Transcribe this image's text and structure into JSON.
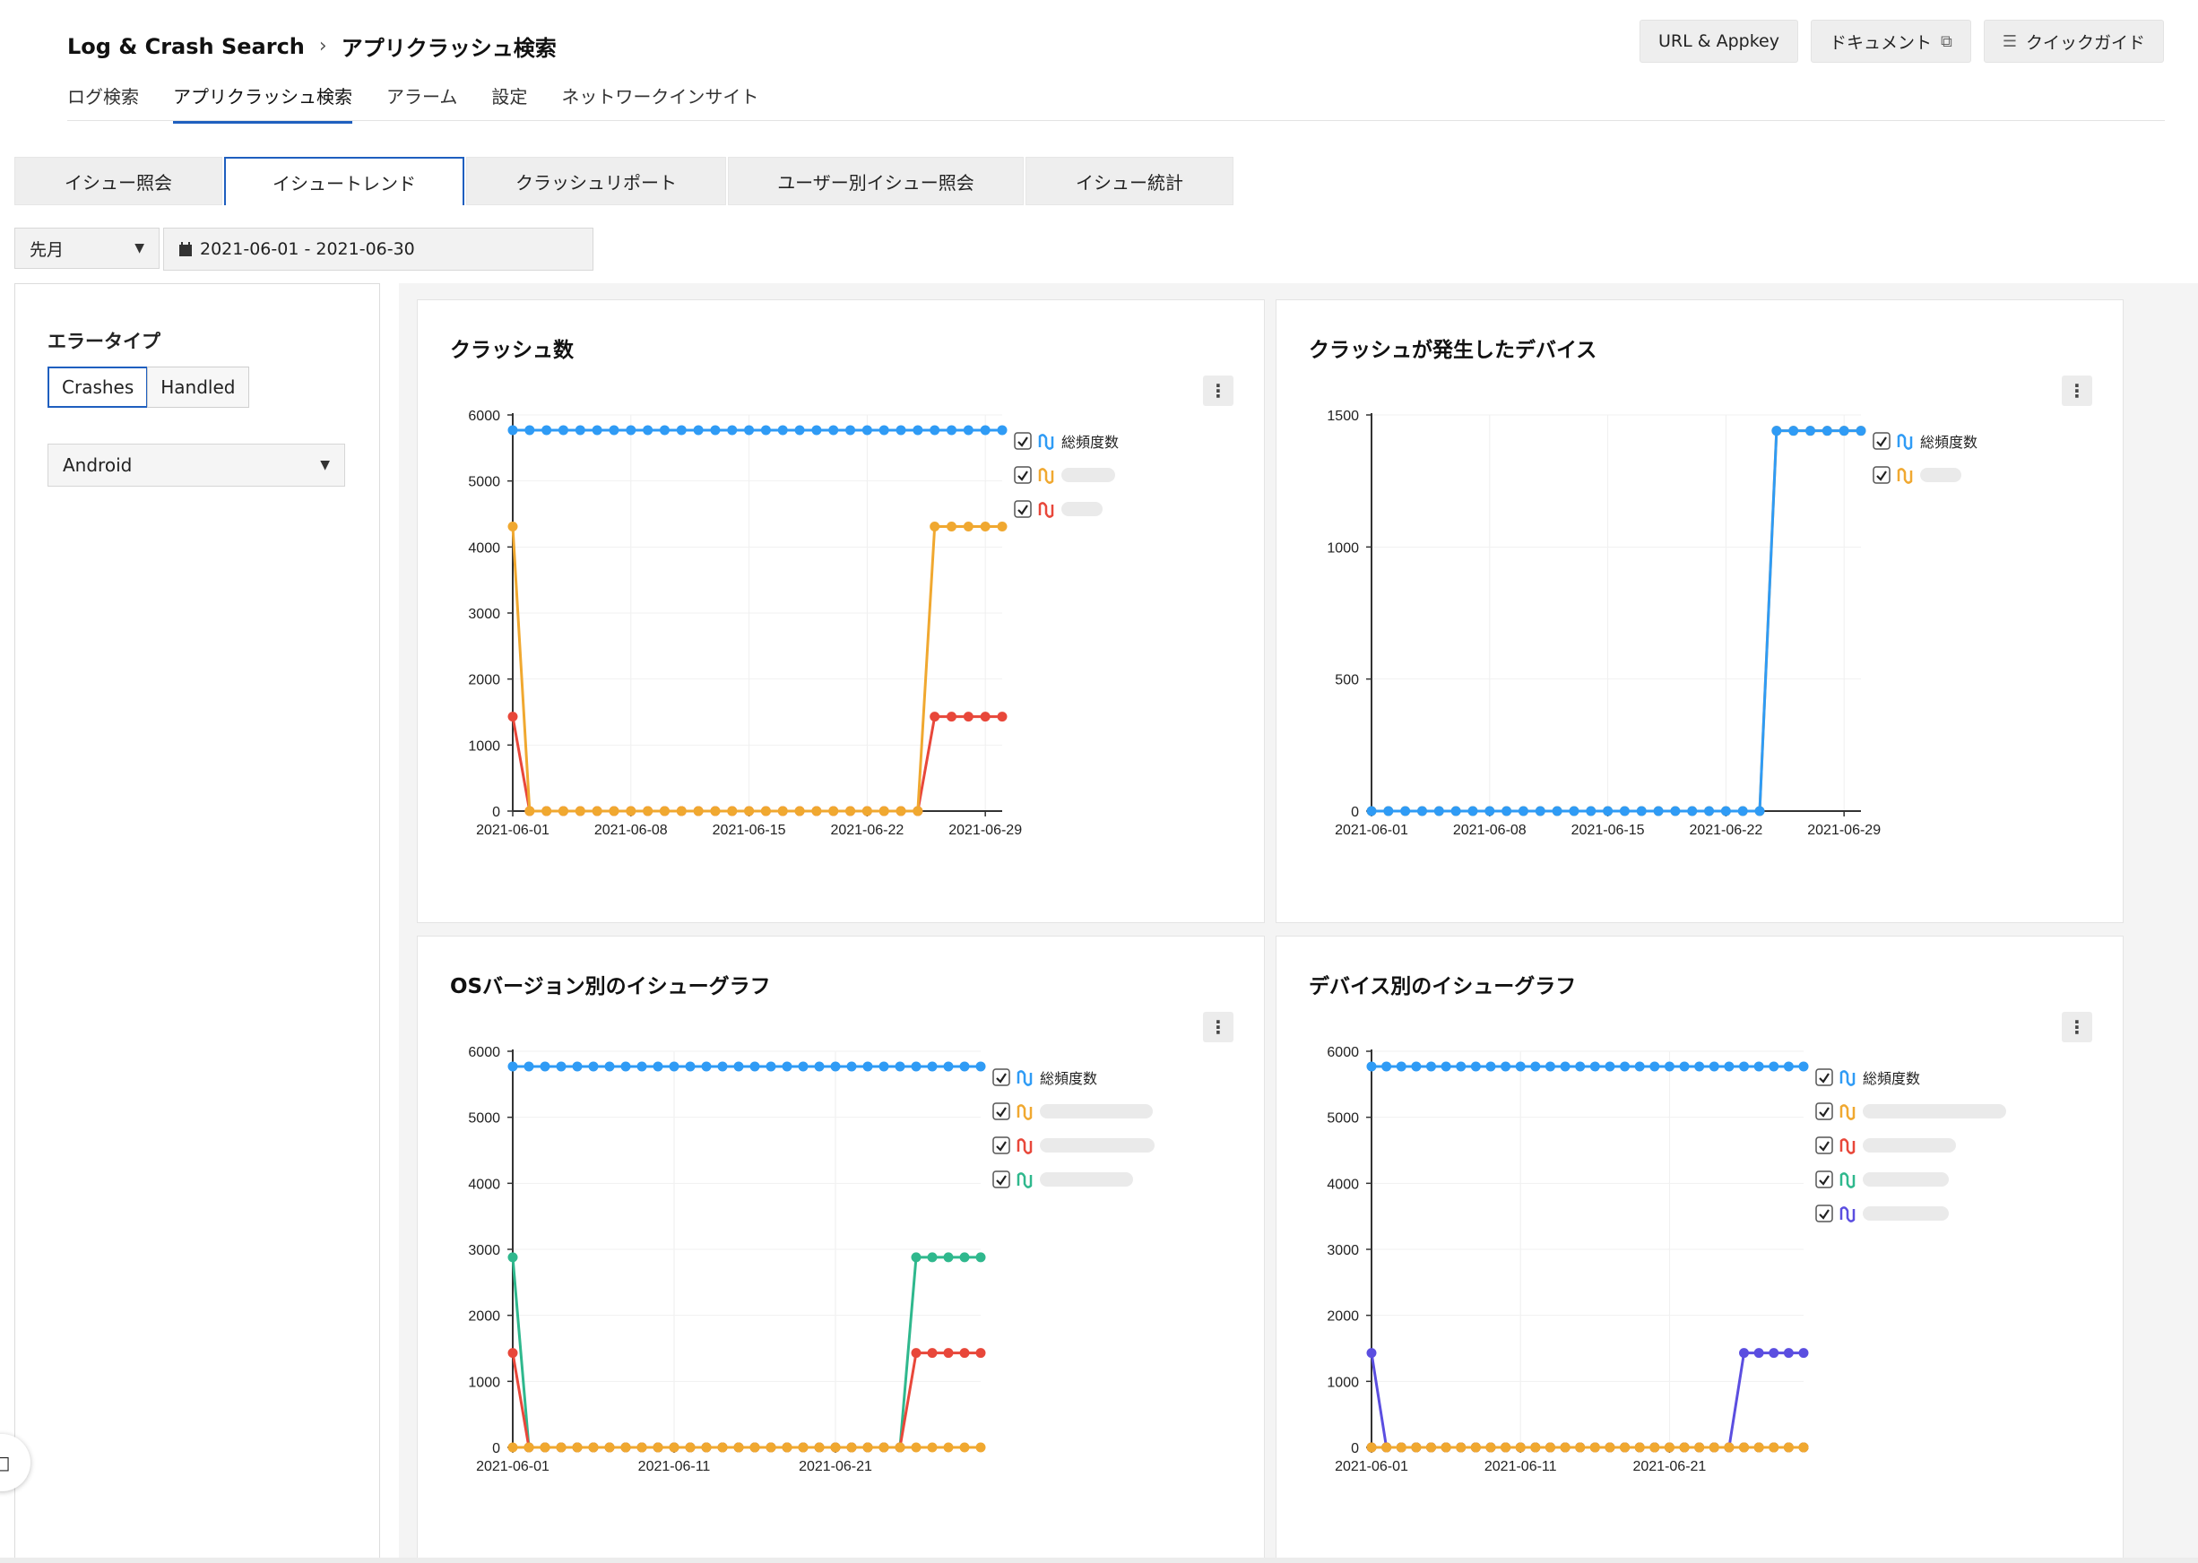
{
  "breadcrumb": {
    "root": "Log & Crash Search",
    "separator": "›",
    "current": "アプリクラッシュ検索"
  },
  "top_nav": [
    "ログ検索",
    "アプリクラッシュ検索",
    "アラーム",
    "設定",
    "ネットワークインサイト"
  ],
  "top_nav_active": 1,
  "top_buttons": {
    "appkey": "URL & Appkey",
    "docs": "ドキュメント",
    "guide": "クイックガイド"
  },
  "tabs": [
    "イシュー照会",
    "イシュートレンド",
    "クラッシュリポート",
    "ユーザー別イシュー照会",
    "イシュー統計"
  ],
  "tabs_active": 1,
  "filters": {
    "period": "先月",
    "date_range": "2021-06-01 - 2021-06-30"
  },
  "sidebar": {
    "error_type_title": "エラータイプ",
    "crashes": "Crashes",
    "handled": "Handled",
    "os_select": "Android"
  },
  "colors": {
    "blue": "#2f9bf5",
    "orange": "#f0a830",
    "red": "#e8473a",
    "green": "#2fb88d",
    "purple": "#5b4ee0",
    "accent": "#1f5fbf"
  },
  "chart_data": [
    {
      "type": "line",
      "title": "クラッシュ数",
      "ylim": [
        0,
        6000
      ],
      "yticks": [
        0,
        1000,
        2000,
        3000,
        4000,
        5000,
        6000
      ],
      "xtick_labels": [
        "2021-06-01",
        "2021-06-08",
        "2021-06-15",
        "2021-06-22",
        "2021-06-29"
      ],
      "x_start": "2021-06-01",
      "x_end": "2021-06-30",
      "series": [
        {
          "name": "総頻度数",
          "color": "#2f9bf5",
          "values": [
            5770,
            5770,
            5770,
            5770,
            5770,
            5770,
            5770,
            5770,
            5770,
            5770,
            5770,
            5770,
            5770,
            5770,
            5770,
            5770,
            5770,
            5770,
            5770,
            5770,
            5770,
            5770,
            5770,
            5770,
            5770,
            5770,
            5770,
            5770,
            5770,
            5770
          ]
        },
        {
          "name": "",
          "color": "#f0a830",
          "values": [
            4310,
            0,
            0,
            0,
            0,
            0,
            0,
            0,
            0,
            0,
            0,
            0,
            0,
            0,
            0,
            0,
            0,
            0,
            0,
            0,
            0,
            0,
            0,
            0,
            0,
            4310,
            4310,
            4310,
            4310,
            4310
          ]
        },
        {
          "name": "",
          "color": "#e8473a",
          "values": [
            1430,
            0,
            0,
            0,
            0,
            0,
            0,
            0,
            0,
            0,
            0,
            0,
            0,
            0,
            0,
            0,
            0,
            0,
            0,
            0,
            0,
            0,
            0,
            0,
            0,
            1430,
            1430,
            1430,
            1430,
            1430
          ]
        }
      ]
    },
    {
      "type": "line",
      "title": "クラッシュが発生したデバイス",
      "ylim": [
        0,
        1500
      ],
      "yticks": [
        0,
        500,
        1000,
        1500
      ],
      "xtick_labels": [
        "2021-06-01",
        "2021-06-08",
        "2021-06-15",
        "2021-06-22",
        "2021-06-29"
      ],
      "x_start": "2021-06-01",
      "x_end": "2021-06-30",
      "series": [
        {
          "name": "総頻度数",
          "color": "#2f9bf5",
          "values": [
            0,
            0,
            0,
            0,
            0,
            0,
            0,
            0,
            0,
            0,
            0,
            0,
            0,
            0,
            0,
            0,
            0,
            0,
            0,
            0,
            0,
            0,
            0,
            0,
            1440,
            1440,
            1440,
            1440,
            1440,
            1440
          ]
        },
        {
          "name": "",
          "color": "#f0a830",
          "values": [
            0,
            0,
            0,
            0,
            0,
            0,
            0,
            0,
            0,
            0,
            0,
            0,
            0,
            0,
            0,
            0,
            0,
            0,
            0,
            0,
            0,
            0,
            0,
            0,
            1440,
            1440,
            1440,
            1440,
            1440,
            1440
          ]
        }
      ]
    },
    {
      "type": "line",
      "title": "OSバージョン別のイシューグラフ",
      "ylim": [
        0,
        6000
      ],
      "yticks": [
        0,
        1000,
        2000,
        3000,
        4000,
        5000,
        6000
      ],
      "xtick_labels": [
        "2021-06-01",
        "2021-06-11",
        "2021-06-21"
      ],
      "x_start": "2021-06-01",
      "x_end": "2021-06-30",
      "series": [
        {
          "name": "総頻度数",
          "color": "#2f9bf5",
          "values": [
            5770,
            5770,
            5770,
            5770,
            5770,
            5770,
            5770,
            5770,
            5770,
            5770,
            5770,
            5770,
            5770,
            5770,
            5770,
            5770,
            5770,
            5770,
            5770,
            5770,
            5770,
            5770,
            5770,
            5770,
            5770,
            5770,
            5770,
            5770,
            5770,
            5770
          ]
        },
        {
          "name": "",
          "color": "#f0a830",
          "values": [
            0,
            0,
            0,
            0,
            0,
            0,
            0,
            0,
            0,
            0,
            0,
            0,
            0,
            0,
            0,
            0,
            0,
            0,
            0,
            0,
            0,
            0,
            0,
            0,
            0,
            0,
            0,
            0,
            0,
            0
          ]
        },
        {
          "name": "",
          "color": "#e8473a",
          "values": [
            1430,
            0,
            0,
            0,
            0,
            0,
            0,
            0,
            0,
            0,
            0,
            0,
            0,
            0,
            0,
            0,
            0,
            0,
            0,
            0,
            0,
            0,
            0,
            0,
            0,
            1430,
            1430,
            1430,
            1430,
            1430
          ]
        },
        {
          "name": "",
          "color": "#2fb88d",
          "values": [
            2880,
            0,
            0,
            0,
            0,
            0,
            0,
            0,
            0,
            0,
            0,
            0,
            0,
            0,
            0,
            0,
            0,
            0,
            0,
            0,
            0,
            0,
            0,
            0,
            0,
            2880,
            2880,
            2880,
            2880,
            2880
          ]
        }
      ]
    },
    {
      "type": "line",
      "title": "デバイス別のイシューグラフ",
      "ylim": [
        0,
        6000
      ],
      "yticks": [
        0,
        1000,
        2000,
        3000,
        4000,
        5000,
        6000
      ],
      "xtick_labels": [
        "2021-06-01",
        "2021-06-11",
        "2021-06-21"
      ],
      "x_start": "2021-06-01",
      "x_end": "2021-06-30",
      "series": [
        {
          "name": "総頻度数",
          "color": "#2f9bf5",
          "values": [
            5770,
            5770,
            5770,
            5770,
            5770,
            5770,
            5770,
            5770,
            5770,
            5770,
            5770,
            5770,
            5770,
            5770,
            5770,
            5770,
            5770,
            5770,
            5770,
            5770,
            5770,
            5770,
            5770,
            5770,
            5770,
            5770,
            5770,
            5770,
            5770,
            5770
          ]
        },
        {
          "name": "",
          "color": "#f0a830",
          "values": [
            0,
            0,
            0,
            0,
            0,
            0,
            0,
            0,
            0,
            0,
            0,
            0,
            0,
            0,
            0,
            0,
            0,
            0,
            0,
            0,
            0,
            0,
            0,
            0,
            0,
            0,
            0,
            0,
            0,
            0
          ]
        },
        {
          "name": "",
          "color": "#e8473a",
          "values": [
            0,
            0,
            0,
            0,
            0,
            0,
            0,
            0,
            0,
            0,
            0,
            0,
            0,
            0,
            0,
            0,
            0,
            0,
            0,
            0,
            0,
            0,
            0,
            0,
            0,
            0,
            0,
            0,
            0,
            0
          ]
        },
        {
          "name": "",
          "color": "#2fb88d",
          "values": [
            0,
            0,
            0,
            0,
            0,
            0,
            0,
            0,
            0,
            0,
            0,
            0,
            0,
            0,
            0,
            0,
            0,
            0,
            0,
            0,
            0,
            0,
            0,
            0,
            0,
            0,
            0,
            0,
            0,
            0
          ]
        },
        {
          "name": "",
          "color": "#5b4ee0",
          "values": [
            1430,
            0,
            0,
            0,
            0,
            0,
            0,
            0,
            0,
            0,
            0,
            0,
            0,
            0,
            0,
            0,
            0,
            0,
            0,
            0,
            0,
            0,
            0,
            0,
            0,
            1430,
            1430,
            1430,
            1430,
            1430
          ]
        }
      ]
    }
  ]
}
